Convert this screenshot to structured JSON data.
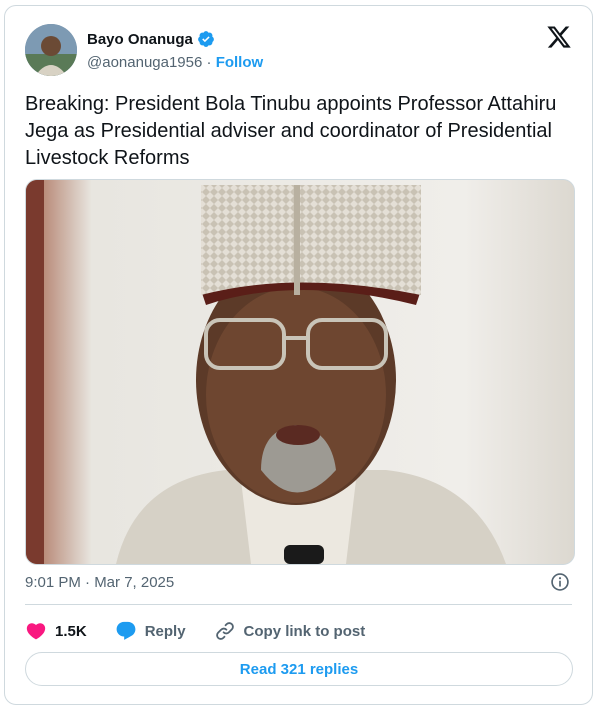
{
  "author": {
    "name": "Bayo Onanuga",
    "handle": "@aonanuga1956",
    "separator": "·",
    "follow_label": "Follow"
  },
  "tweet": {
    "text": "Breaking: President Bola Tinubu appoints Professor Attahiru Jega as Presidential adviser and coordinator of Presidential Livestock Reforms",
    "timestamp": "9:01 PM · Mar 7, 2025"
  },
  "actions": {
    "like_count": "1.5K",
    "reply_label": "Reply",
    "copy_label": "Copy link to post"
  },
  "read_replies_label": "Read 321 replies",
  "colors": {
    "accent": "#1d9bf0",
    "like": "#f91880",
    "text": "#0f1419",
    "secondary": "#536471",
    "border": "#cfd9de"
  },
  "icons": [
    "verified-badge-icon",
    "x-logo-icon",
    "info-icon",
    "heart-icon",
    "reply-icon",
    "link-icon"
  ]
}
